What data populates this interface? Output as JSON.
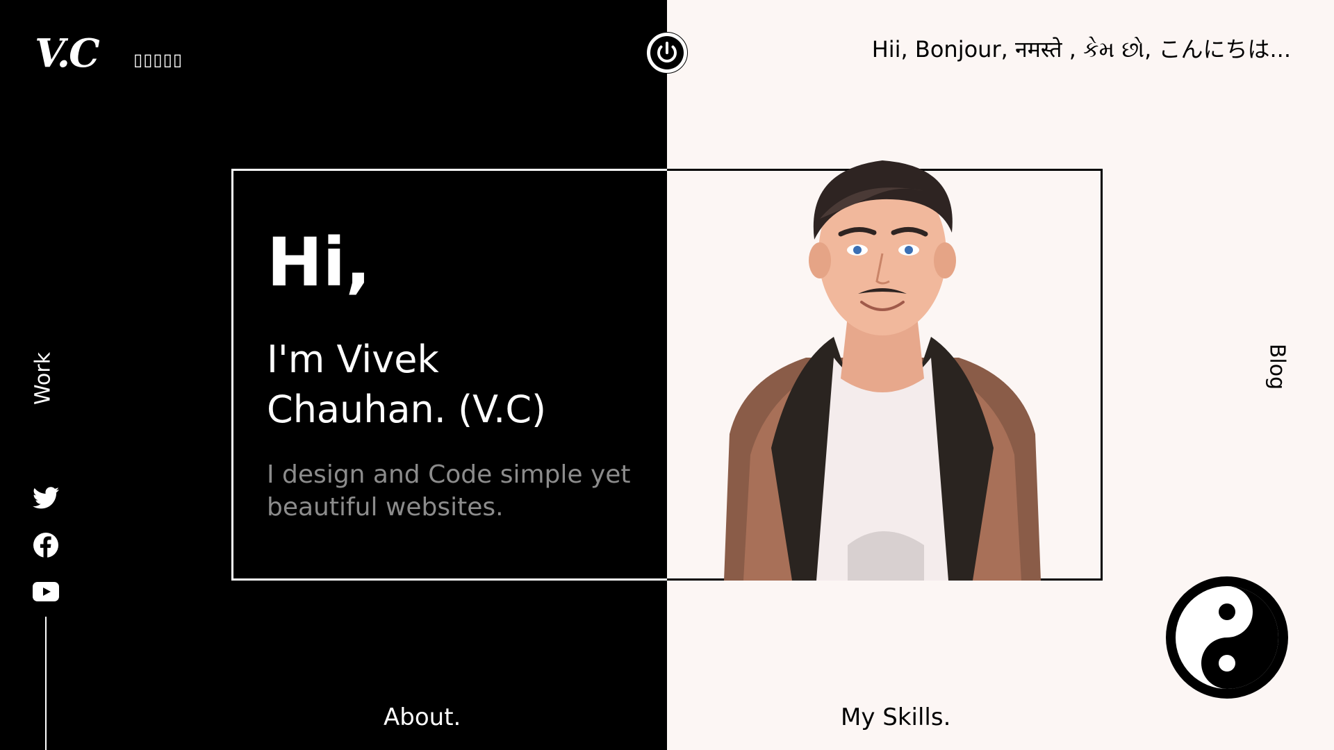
{
  "brand": {
    "logo": "V.C",
    "glyphs": "▯▯▯▯▯"
  },
  "greeting": "Hii, Bonjour, नमस्ते , કેમ છો, こんにちは...",
  "hero": {
    "hi": "Hi,",
    "name_line1": "I'm Vivek",
    "name_line2": "Chauhan. (V.C)",
    "tagline_line1": "I design and Code simple yet",
    "tagline_line2": "beautiful websites."
  },
  "nav": {
    "work": "Work",
    "blog": "Blog",
    "about": "About.",
    "skills": "My Skills."
  },
  "icons": {
    "power": "power-icon",
    "twitter": "twitter-icon",
    "facebook": "facebook-icon",
    "youtube": "youtube-icon",
    "theme": "yin-yang-icon"
  },
  "colors": {
    "dark": "#000000",
    "light": "#fcf6f4",
    "muted_text": "#8c8c8c"
  }
}
